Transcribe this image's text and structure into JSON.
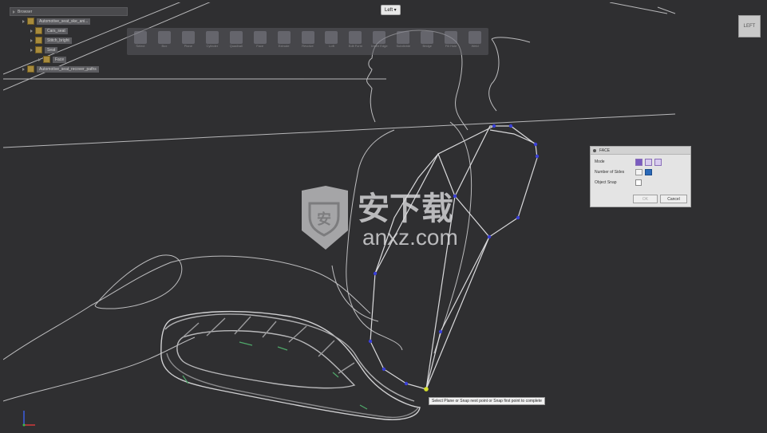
{
  "browser": {
    "title": "Browser",
    "nodes": [
      {
        "label": "Automotive_seat_ske_ani..."
      },
      {
        "label": "Cars_seat"
      },
      {
        "label": "Stitch_bright"
      },
      {
        "label": "Seat"
      },
      {
        "label": "Face"
      },
      {
        "label": "Automotive_seat_recover_paths"
      }
    ]
  },
  "toolbar": {
    "tools": [
      {
        "label": "Select",
        "icon": "select-icon"
      },
      {
        "label": "Box",
        "icon": "box-icon"
      },
      {
        "label": "Plane",
        "icon": "plane-icon"
      },
      {
        "label": "Cylinder",
        "icon": "cylinder-icon"
      },
      {
        "label": "Quadball",
        "icon": "quadball-icon"
      },
      {
        "label": "Face",
        "icon": "face-icon"
      },
      {
        "label": "Extrude",
        "icon": "extrude-icon"
      },
      {
        "label": "Revolve",
        "icon": "revolve-icon"
      },
      {
        "label": "Loft",
        "icon": "loft-icon"
      },
      {
        "label": "Edit Form",
        "icon": "edit-form-icon"
      },
      {
        "label": "Insert Edge",
        "icon": "insert-edge-icon"
      },
      {
        "label": "Subdivide",
        "icon": "subdivide-icon"
      },
      {
        "label": "Bridge",
        "icon": "bridge-icon"
      },
      {
        "label": "Fill Hole",
        "icon": "fill-hole-icon"
      },
      {
        "label": "Weld",
        "icon": "weld-icon"
      }
    ]
  },
  "view_dropdown": {
    "label": "Left ▾"
  },
  "viewcube": {
    "label": "LEFT"
  },
  "face_dialog": {
    "title": "FACE",
    "mode_label": "Mode",
    "sides_label": "Number of Sides",
    "snap_label": "Object Snap",
    "ok_label": "OK",
    "cancel_label": "Cancel"
  },
  "tooltip": {
    "text": "Select Plane or Snap next point or Snap first point to complete"
  },
  "watermark": {
    "text_cn": "安下载",
    "text_en": "anxz.com"
  },
  "colors": {
    "background": "#2f2f31",
    "curve": "#c7c7c9",
    "control_point": "#3a40d8",
    "active_point": "#d6e02a",
    "mode_accent": "#7a5cc0"
  }
}
